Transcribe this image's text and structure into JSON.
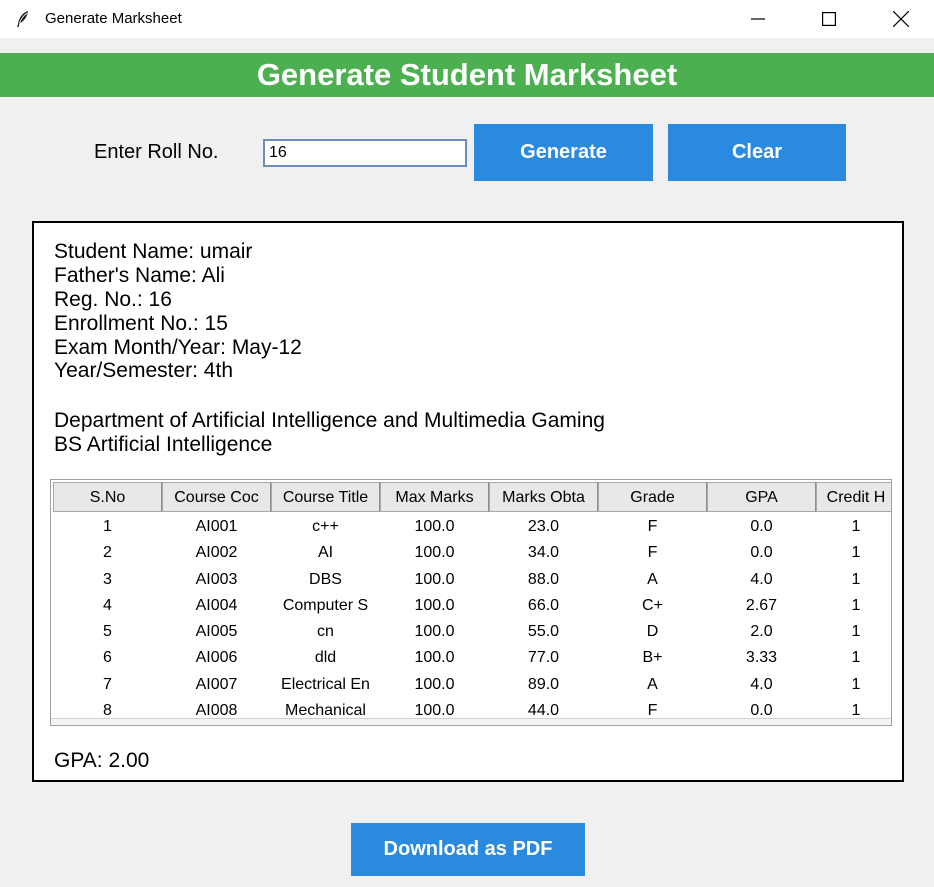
{
  "window": {
    "title": "Generate Marksheet"
  },
  "header": {
    "title": "Generate Student Marksheet"
  },
  "form": {
    "roll_label": "Enter Roll No.",
    "roll_value": "16",
    "generate_label": "Generate",
    "clear_label": "Clear"
  },
  "student": {
    "name": "Student Name: umair",
    "father": "Father's Name: Ali",
    "reg": "Reg. No.: 16",
    "enrollment": "Enrollment No.: 15",
    "exam": "Exam Month/Year: May-12",
    "semester": "Year/Semester: 4th",
    "department": "Department of Artificial Intelligence and Multimedia Gaming",
    "program": "BS Artificial Intelligence"
  },
  "table": {
    "columns": [
      "S.No",
      "Course Coc",
      "Course Title",
      "Max Marks",
      "Marks Obta",
      "Grade",
      "GPA",
      "Credit H"
    ],
    "rows": [
      [
        "1",
        "AI001",
        "c++",
        "100.0",
        "23.0",
        "F",
        "0.0",
        "1"
      ],
      [
        "2",
        "AI002",
        "AI",
        "100.0",
        "34.0",
        "F",
        "0.0",
        "1"
      ],
      [
        "3",
        "AI003",
        "DBS",
        "100.0",
        "88.0",
        "A",
        "4.0",
        "1"
      ],
      [
        "4",
        "AI004",
        "Computer S",
        "100.0",
        "66.0",
        "C+",
        "2.67",
        "1"
      ],
      [
        "5",
        "AI005",
        "cn",
        "100.0",
        "55.0",
        "D",
        "2.0",
        "1"
      ],
      [
        "6",
        "AI006",
        "dld",
        "100.0",
        "77.0",
        "B+",
        "3.33",
        "1"
      ],
      [
        "7",
        "AI007",
        "Electrical En",
        "100.0",
        "89.0",
        "A",
        "4.0",
        "1"
      ],
      [
        "8",
        "AI008",
        "Mechanical",
        "100.0",
        "44.0",
        "F",
        "0.0",
        "1"
      ]
    ]
  },
  "summary": {
    "gpa": "GPA: 2.00"
  },
  "actions": {
    "download_label": "Download as PDF"
  },
  "colors": {
    "banner": "#4caf50",
    "button": "#2a8ae0"
  }
}
